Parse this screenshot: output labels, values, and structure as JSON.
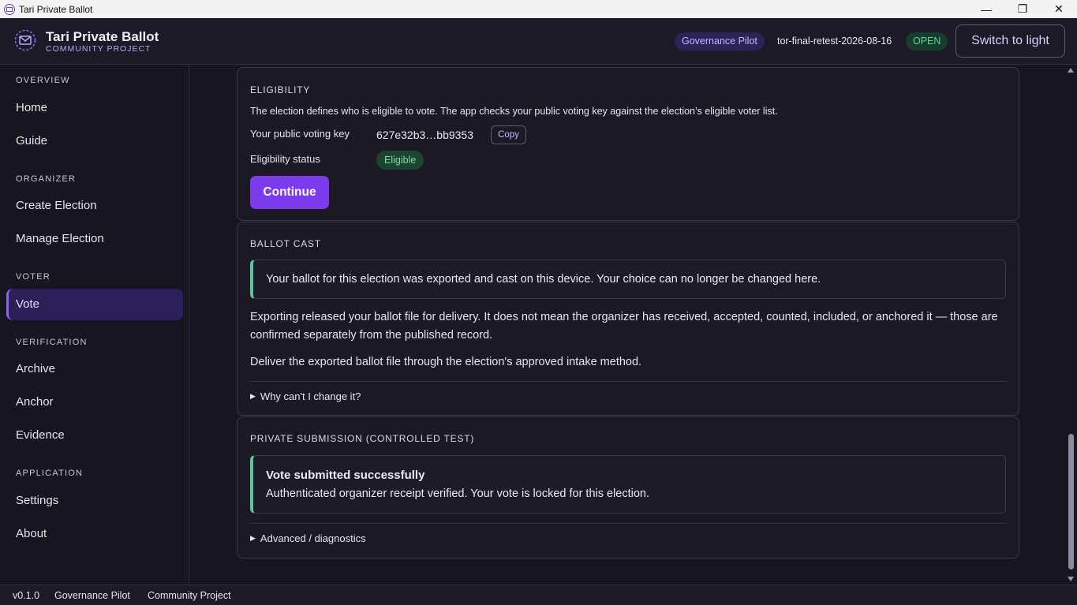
{
  "window": {
    "title": "Tari Private Ballot",
    "controls": {
      "minimize": "—",
      "restore": "❐",
      "close": "✕"
    }
  },
  "header": {
    "brand_title": "Tari Private Ballot",
    "brand_subtitle": "COMMUNITY PROJECT",
    "governance_pill": "Governance Pilot",
    "election_id": "tor-final-retest-2026-08-16",
    "status_pill": "OPEN",
    "theme_button": "Switch to light"
  },
  "sidebar": {
    "sections": [
      {
        "label": "OVERVIEW",
        "items": [
          {
            "label": "Home"
          },
          {
            "label": "Guide"
          }
        ]
      },
      {
        "label": "ORGANIZER",
        "items": [
          {
            "label": "Create Election"
          },
          {
            "label": "Manage Election"
          }
        ]
      },
      {
        "label": "VOTER",
        "items": [
          {
            "label": "Vote",
            "active": true
          }
        ]
      },
      {
        "label": "VERIFICATION",
        "items": [
          {
            "label": "Archive"
          },
          {
            "label": "Anchor"
          },
          {
            "label": "Evidence"
          }
        ]
      },
      {
        "label": "APPLICATION",
        "items": [
          {
            "label": "Settings"
          },
          {
            "label": "About"
          }
        ]
      }
    ]
  },
  "eligibility": {
    "heading": "ELIGIBILITY",
    "description": "The election defines who is eligible to vote. The app checks your public voting key against the election’s eligible voter list.",
    "key_label": "Your public voting key",
    "key_value": "627e32b3…bb9353",
    "copy_label": "Copy",
    "status_label": "Eligibility status",
    "status_value": "Eligible",
    "continue_label": "Continue"
  },
  "ballot_cast": {
    "heading": "BALLOT CAST",
    "callout": "Your ballot for this election was exported and cast on this device. Your choice can no longer be changed here.",
    "paragraph1": "Exporting released your ballot file for delivery. It does not mean the organizer has received, accepted, counted, included, or anchored it — those are confirmed separately from the published record.",
    "paragraph2": "Deliver the exported ballot file through the election's approved intake method.",
    "disclosure": "Why can't I change it?"
  },
  "private_submission": {
    "heading": "PRIVATE SUBMISSION (CONTROLLED TEST)",
    "callout_title": "Vote submitted successfully",
    "callout_text": "Authenticated organizer receipt verified. Your vote is locked for this election.",
    "disclosure": "Advanced / diagnostics"
  },
  "statusbar": {
    "version": "v0.1.0",
    "pilot": "Governance Pilot",
    "project": "Community Project"
  },
  "colors": {
    "accent": "#7c3aed",
    "success": "#5ec59a",
    "background": "#17151f"
  }
}
